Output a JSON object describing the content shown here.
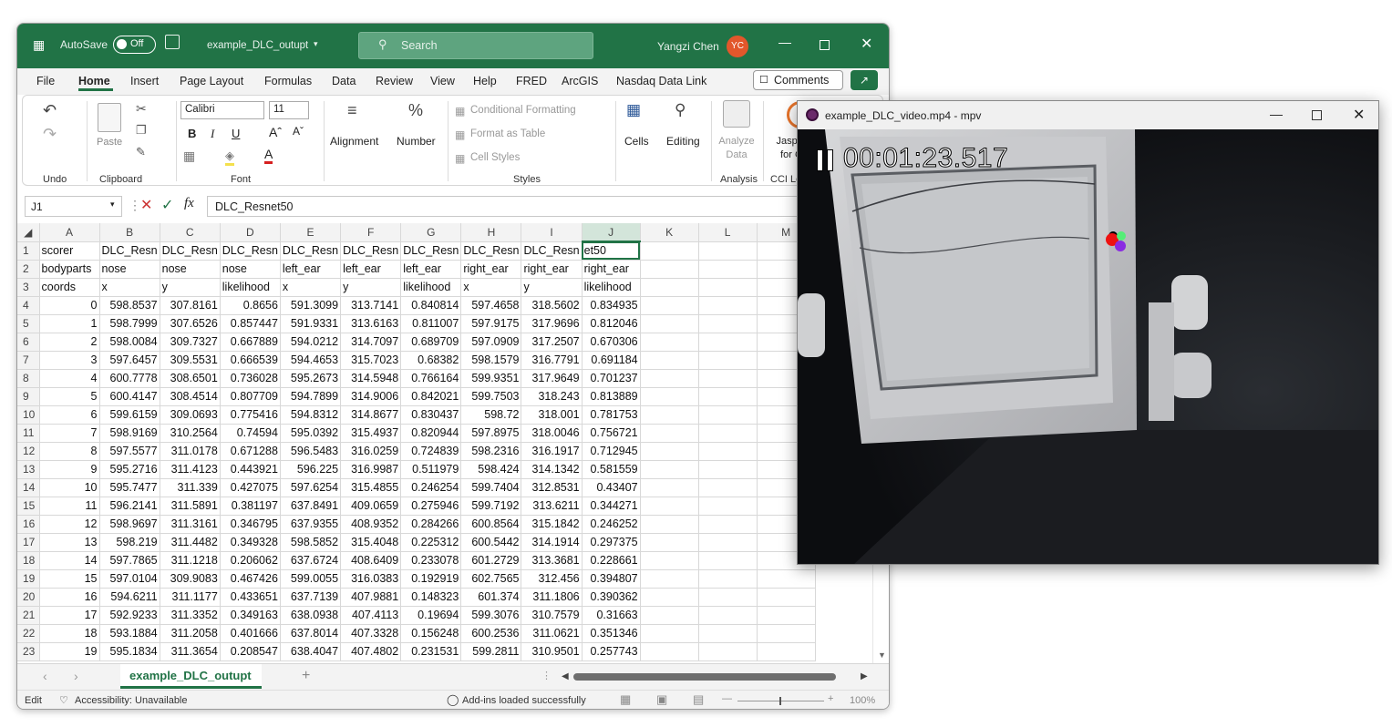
{
  "excel": {
    "autosave_label": "AutoSave",
    "autosave_state": "Off",
    "file_name": "example_DLC_outupt",
    "search_placeholder": "Search",
    "user_name": "Yangzi Chen",
    "user_initials": "YC",
    "tabs": [
      "File",
      "Home",
      "Insert",
      "Page Layout",
      "Formulas",
      "Data",
      "Review",
      "View",
      "Help",
      "FRED",
      "ArcGIS",
      "Nasdaq Data Link"
    ],
    "active_tab": "Home",
    "comments_label": "Comments",
    "ribbon": {
      "undo_group": "Undo",
      "paste_label": "Paste",
      "clipboard_group": "Clipboard",
      "font_name": "Calibri",
      "font_size": "11",
      "font_group": "Font",
      "alignment_label": "Alignment",
      "number_label": "Number",
      "conditional_formatting": "Conditional Formatting",
      "format_as_table": "Format as Table",
      "cell_styles": "Cell Styles",
      "styles_group": "Styles",
      "cells_label": "Cells",
      "editing_label": "Editing",
      "analyze_data": "Analyze Data",
      "analysis_group": "Analysis",
      "jasper_label": "Jasper for C",
      "cci_group": "CCI Le"
    },
    "name_box": "J1",
    "formula_content": "DLC_Resnet50",
    "column_headers": [
      "A",
      "B",
      "C",
      "D",
      "E",
      "F",
      "G",
      "H",
      "I",
      "J",
      "K",
      "L",
      "M"
    ],
    "rows": [
      {
        "n": "1",
        "c": [
          "scorer",
          "DLC_Resn",
          "DLC_Resn",
          "DLC_Resn",
          "DLC_Resn",
          "DLC_Resn",
          "DLC_Resn",
          "DLC_Resn",
          "DLC_Resn",
          "et50"
        ]
      },
      {
        "n": "2",
        "c": [
          "bodyparts",
          "nose",
          "nose",
          "nose",
          "left_ear",
          "left_ear",
          "left_ear",
          "right_ear",
          "right_ear",
          "right_ear"
        ]
      },
      {
        "n": "3",
        "c": [
          "coords",
          "x",
          "y",
          "likelihood",
          "x",
          "y",
          "likelihood",
          "x",
          "y",
          "likelihood"
        ]
      },
      {
        "n": "4",
        "c": [
          "0",
          "598.8537",
          "307.8161",
          "0.8656",
          "591.3099",
          "313.7141",
          "0.840814",
          "597.4658",
          "318.5602",
          "0.834935"
        ]
      },
      {
        "n": "5",
        "c": [
          "1",
          "598.7999",
          "307.6526",
          "0.857447",
          "591.9331",
          "313.6163",
          "0.811007",
          "597.9175",
          "317.9696",
          "0.812046"
        ]
      },
      {
        "n": "6",
        "c": [
          "2",
          "598.0084",
          "309.7327",
          "0.667889",
          "594.0212",
          "314.7097",
          "0.689709",
          "597.0909",
          "317.2507",
          "0.670306"
        ]
      },
      {
        "n": "7",
        "c": [
          "3",
          "597.6457",
          "309.5531",
          "0.666539",
          "594.4653",
          "315.7023",
          "0.68382",
          "598.1579",
          "316.7791",
          "0.691184"
        ]
      },
      {
        "n": "8",
        "c": [
          "4",
          "600.7778",
          "308.6501",
          "0.736028",
          "595.2673",
          "314.5948",
          "0.766164",
          "599.9351",
          "317.9649",
          "0.701237"
        ]
      },
      {
        "n": "9",
        "c": [
          "5",
          "600.4147",
          "308.4514",
          "0.807709",
          "594.7899",
          "314.9006",
          "0.842021",
          "599.7503",
          "318.243",
          "0.813889"
        ]
      },
      {
        "n": "10",
        "c": [
          "6",
          "599.6159",
          "309.0693",
          "0.775416",
          "594.8312",
          "314.8677",
          "0.830437",
          "598.72",
          "318.001",
          "0.781753"
        ]
      },
      {
        "n": "11",
        "c": [
          "7",
          "598.9169",
          "310.2564",
          "0.74594",
          "595.0392",
          "315.4937",
          "0.820944",
          "597.8975",
          "318.0046",
          "0.756721"
        ]
      },
      {
        "n": "12",
        "c": [
          "8",
          "597.5577",
          "311.0178",
          "0.671288",
          "596.5483",
          "316.0259",
          "0.724839",
          "598.2316",
          "316.1917",
          "0.712945"
        ]
      },
      {
        "n": "13",
        "c": [
          "9",
          "595.2716",
          "311.4123",
          "0.443921",
          "596.225",
          "316.9987",
          "0.511979",
          "598.424",
          "314.1342",
          "0.581559"
        ]
      },
      {
        "n": "14",
        "c": [
          "10",
          "595.7477",
          "311.339",
          "0.427075",
          "597.6254",
          "315.4855",
          "0.246254",
          "599.7404",
          "312.8531",
          "0.43407"
        ]
      },
      {
        "n": "15",
        "c": [
          "11",
          "596.2141",
          "311.5891",
          "0.381197",
          "637.8491",
          "409.0659",
          "0.275946",
          "599.7192",
          "313.6211",
          "0.344271"
        ]
      },
      {
        "n": "16",
        "c": [
          "12",
          "598.9697",
          "311.3161",
          "0.346795",
          "637.9355",
          "408.9352",
          "0.284266",
          "600.8564",
          "315.1842",
          "0.246252"
        ]
      },
      {
        "n": "17",
        "c": [
          "13",
          "598.219",
          "311.4482",
          "0.349328",
          "598.5852",
          "315.4048",
          "0.225312",
          "600.5442",
          "314.1914",
          "0.297375"
        ]
      },
      {
        "n": "18",
        "c": [
          "14",
          "597.7865",
          "311.1218",
          "0.206062",
          "637.6724",
          "408.6409",
          "0.233078",
          "601.2729",
          "313.3681",
          "0.228661"
        ]
      },
      {
        "n": "19",
        "c": [
          "15",
          "597.0104",
          "309.9083",
          "0.467426",
          "599.0055",
          "316.0383",
          "0.192919",
          "602.7565",
          "312.456",
          "0.394807"
        ]
      },
      {
        "n": "20",
        "c": [
          "16",
          "594.6211",
          "311.1177",
          "0.433651",
          "637.7139",
          "407.9881",
          "0.148323",
          "601.374",
          "311.1806",
          "0.390362"
        ]
      },
      {
        "n": "21",
        "c": [
          "17",
          "592.9233",
          "311.3352",
          "0.349163",
          "638.0938",
          "407.4113",
          "0.19694",
          "599.3076",
          "310.7579",
          "0.31663"
        ]
      },
      {
        "n": "22",
        "c": [
          "18",
          "593.1884",
          "311.2058",
          "0.401666",
          "637.8014",
          "407.3328",
          "0.156248",
          "600.2536",
          "311.0621",
          "0.351346"
        ]
      },
      {
        "n": "23",
        "c": [
          "19",
          "595.1834",
          "311.3654",
          "0.208547",
          "638.4047",
          "407.4802",
          "0.231531",
          "599.2811",
          "310.9501",
          "0.257743"
        ]
      }
    ],
    "sheet_tab": "example_DLC_outupt",
    "status_mode": "Edit",
    "accessibility": "Accessibility: Unavailable",
    "addins_status": "Add-ins loaded successfully",
    "zoom_level": "100%"
  },
  "mpv": {
    "title": "example_DLC_video.mp4 - mpv",
    "timestamp": "00:01:23.517",
    "playback_state": "paused"
  }
}
